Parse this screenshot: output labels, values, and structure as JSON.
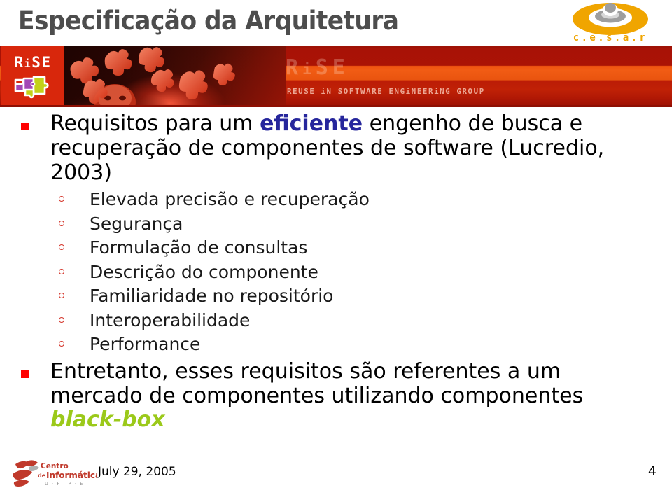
{
  "slide": {
    "title": "Especificação da Arquitetura",
    "page_number": "4",
    "date": "July 29, 2005"
  },
  "header": {
    "cesar_logo_label": "c . e . s . a . r",
    "rise_logo_text": "RiSE",
    "banner_ghost_text": "RiSE",
    "banner_tagline": "REUSE iN SOFTWARE ENGiNEERiNG GROUP"
  },
  "footer": {
    "cin_line1": "Centro",
    "cin_line2_prefix": "de",
    "cin_line2": "Informática",
    "cin_sub": "U · F · P · E"
  },
  "content": {
    "bullet1": {
      "part1": "Requisitos para um ",
      "emphasis": "eficiente",
      "part2": " engenho de busca e recuperação de componentes de software (Lucredio, 2003)"
    },
    "subitems": [
      {
        "label": "Elevada precisão e recuperação"
      },
      {
        "label": "Segurança"
      },
      {
        "label": "Formulação de consultas"
      },
      {
        "label": "Descrição do componente"
      },
      {
        "label": "Familiaridade no repositório"
      },
      {
        "label": "Interoperabilidade"
      },
      {
        "label": "Performance"
      }
    ],
    "bullet2": {
      "part1": "Entretanto, esses requisitos são referentes a um mercado de componentes utilizando componentes ",
      "emphasis": "black-box"
    }
  },
  "colors": {
    "title": "#4d4d4d",
    "bullet_square": "#ff0000",
    "bullet_circle": "#d4352a",
    "emphasis_blue": "#26269c",
    "emphasis_green": "#9bc91a",
    "banner_orange": "#ef5410",
    "banner_dark_red": "#a81206",
    "cesar_orange": "#f0a500",
    "cin_red": "#c0392b"
  }
}
